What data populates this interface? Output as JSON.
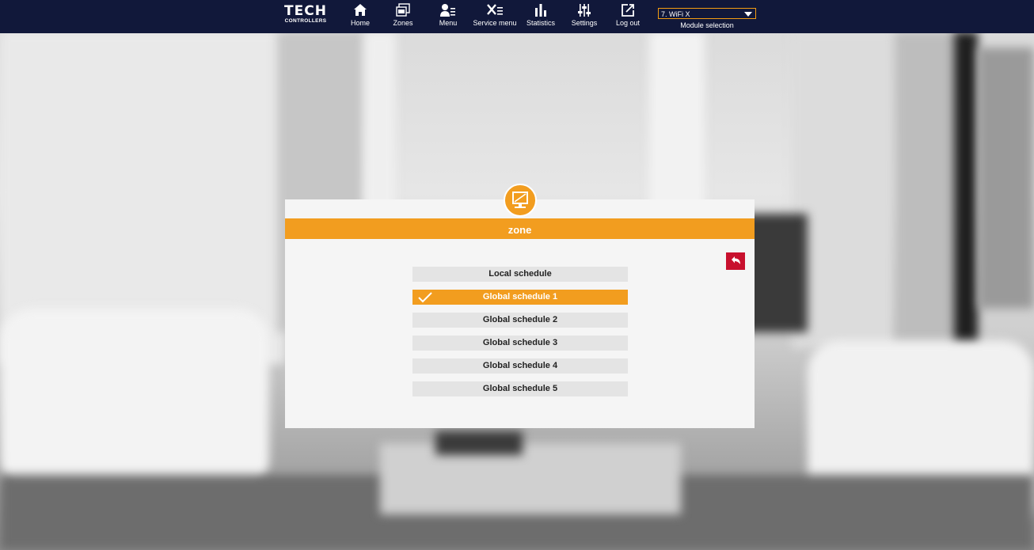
{
  "brand": {
    "name": "TECH",
    "subtitle": "CONTROLLERS"
  },
  "nav": [
    {
      "id": "home",
      "label": "Home",
      "icon": "home-icon"
    },
    {
      "id": "zones",
      "label": "Zones",
      "icon": "zones-icon"
    },
    {
      "id": "menu",
      "label": "Menu",
      "icon": "user-menu-icon"
    },
    {
      "id": "service",
      "label": "Service menu",
      "icon": "tools-icon"
    },
    {
      "id": "statistics",
      "label": "Statistics",
      "icon": "bar-chart-icon"
    },
    {
      "id": "settings",
      "label": "Settings",
      "icon": "sliders-icon"
    },
    {
      "id": "logout",
      "label": "Log out",
      "icon": "logout-icon"
    }
  ],
  "module": {
    "selected": "7. WiFi X",
    "label": "Module selection"
  },
  "panel": {
    "title": "zone",
    "icon": "monitor-icon",
    "back_icon": "back-arrow-icon",
    "options": [
      {
        "label": "Local schedule",
        "selected": false
      },
      {
        "label": "Global schedule 1",
        "selected": true
      },
      {
        "label": "Global schedule 2",
        "selected": false
      },
      {
        "label": "Global schedule 3",
        "selected": false
      },
      {
        "label": "Global schedule 4",
        "selected": false
      },
      {
        "label": "Global schedule 5",
        "selected": false
      }
    ]
  },
  "colors": {
    "nav_bg": "#11183a",
    "accent": "#f29d1f",
    "back": "#c8102e"
  }
}
